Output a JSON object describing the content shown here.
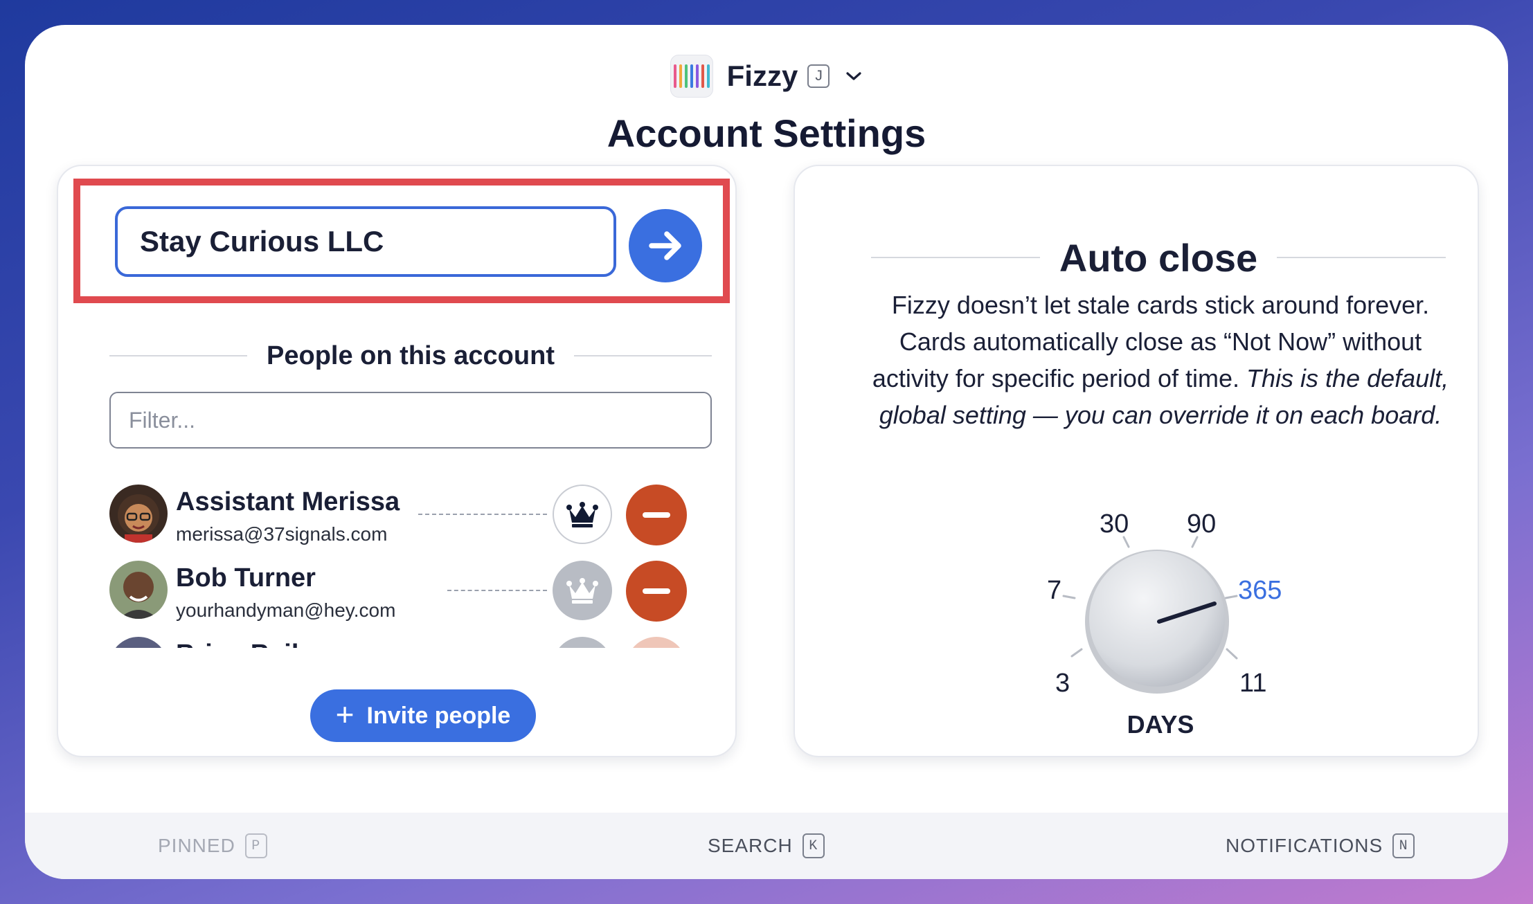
{
  "app": {
    "name": "Fizzy",
    "shortcut": "J",
    "menu_icon": "chevron-down-icon",
    "logo_colors": [
      "#e85a8c",
      "#f2a93b",
      "#4ec27a",
      "#3a7be0",
      "#8a5ae0",
      "#e0584a",
      "#3fb8d0"
    ]
  },
  "page": {
    "title": "Account Settings"
  },
  "account": {
    "name_value": "Stay Curious LLC",
    "submit_icon": "arrow-right-icon"
  },
  "people": {
    "title": "People on this account",
    "filter_placeholder": "Filter...",
    "members": [
      {
        "name": "Assistant Merissa",
        "email": "merissa@37signals.com",
        "admin": true
      },
      {
        "name": "Bob Turner",
        "email": "yourhandyman@hey.com",
        "admin": false
      },
      {
        "name": "Brian Bail",
        "email": "",
        "admin": false
      }
    ],
    "invite_label": "Invite people",
    "invite_icon": "plus-icon"
  },
  "auto_close": {
    "title": "Auto close",
    "description_plain": "Fizzy doesn’t let stale cards stick around forever. Cards automatically close as “Not Now” without activity for specific period of time.",
    "description_italic": "This is the default, global setting — you can override it on each board.",
    "dial_options": [
      "3",
      "7",
      "30",
      "90",
      "365",
      "11"
    ],
    "selected": "365",
    "unit": "DAYS"
  },
  "footer": {
    "pinned": {
      "label": "PINNED",
      "key": "P"
    },
    "search": {
      "label": "SEARCH",
      "key": "K"
    },
    "notifications": {
      "label": "NOTIFICATIONS",
      "key": "N"
    }
  },
  "colors": {
    "accent": "#3a6fe0",
    "remove": "#c74b25",
    "highlight": "#e04a4f"
  }
}
